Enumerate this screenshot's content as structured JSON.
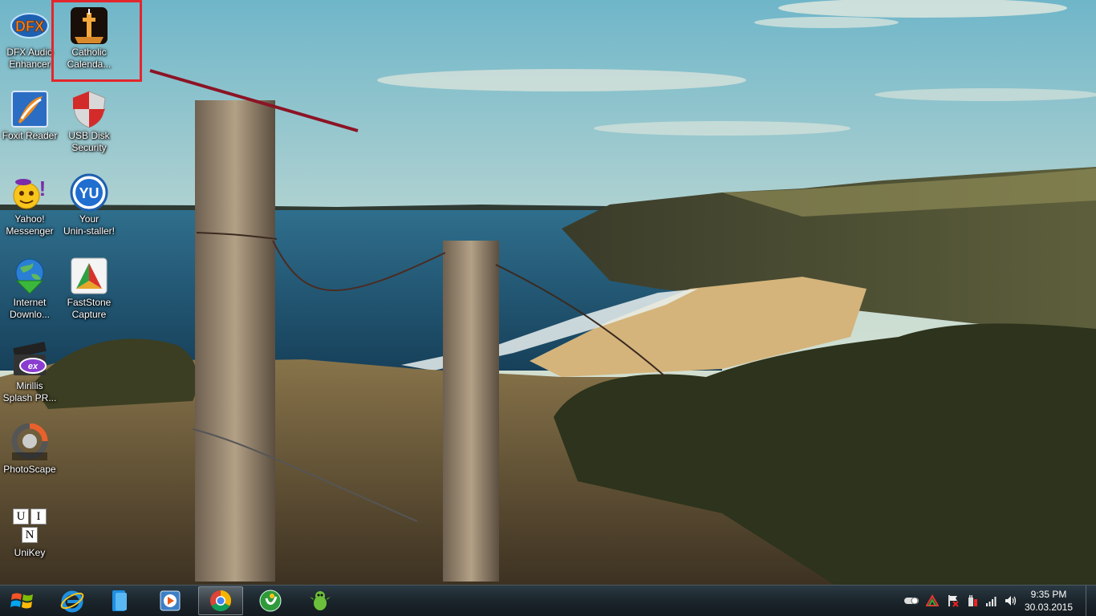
{
  "desktop": {
    "icons": [
      {
        "name": "DFX Audio Enhancer",
        "line1": "DFX Audio",
        "line2": "Enhancer",
        "icon": "dfx-icon"
      },
      {
        "name": "Catholic Calendar",
        "line1": "Catholic",
        "line2": "Calenda...",
        "icon": "catholic-calendar-icon"
      },
      {
        "name": "Foxit Reader",
        "line1": "Foxit Reader",
        "line2": "",
        "icon": "foxit-icon"
      },
      {
        "name": "USB Disk Security",
        "line1": "USB Disk",
        "line2": "Security",
        "icon": "usb-shield-icon"
      },
      {
        "name": "Yahoo! Messenger",
        "line1": "Yahoo!",
        "line2": "Messenger",
        "icon": "yahoo-icon"
      },
      {
        "name": "Your Uninstaller!",
        "line1": "Your",
        "line2": "Unin-staller!",
        "icon": "your-uninstaller-icon"
      },
      {
        "name": "Internet Download Manager",
        "line1": "Internet",
        "line2": "Downlo...",
        "icon": "idm-icon"
      },
      {
        "name": "FastStone Capture",
        "line1": "FastStone",
        "line2": "Capture",
        "icon": "faststone-icon"
      },
      {
        "name": "Mirillis Splash PRO",
        "line1": "Mirillis",
        "line2": "Splash PR...",
        "icon": "mirillis-icon"
      },
      {
        "name": "PhotoScape",
        "line1": "PhotoScape",
        "line2": "",
        "icon": "photoscape-icon"
      },
      {
        "name": "UniKey",
        "line1": "UniKey",
        "line2": "",
        "icon": "unikey-icon"
      }
    ],
    "unikey_letters": [
      "U",
      "I",
      "N"
    ],
    "highlight_color": "#e3262c",
    "annotation_color": "#8b1424"
  },
  "taskbar": {
    "buttons": [
      {
        "name": "start",
        "icon": "windows-start-icon"
      },
      {
        "name": "internet-explorer",
        "icon": "ie-icon"
      },
      {
        "name": "file-explorer",
        "icon": "folder-icon"
      },
      {
        "name": "media-player",
        "icon": "media-player-icon"
      },
      {
        "name": "chrome",
        "icon": "chrome-icon",
        "active": true
      },
      {
        "name": "coccoc",
        "icon": "coccoc-icon"
      },
      {
        "name": "game",
        "icon": "dragon-icon"
      }
    ],
    "tray": {
      "icons": [
        "toggle-icon",
        "unikey-tray-icon",
        "flag-error-icon",
        "power-icon",
        "network-signal-icon",
        "volume-icon"
      ],
      "time": "9:35 PM",
      "date": "30.03.2015"
    }
  }
}
